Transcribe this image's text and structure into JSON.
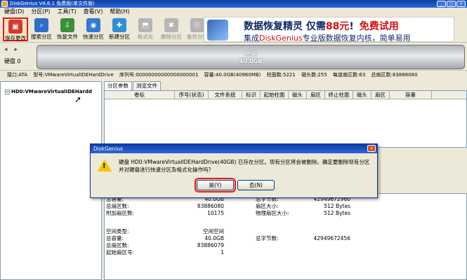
{
  "window": {
    "title": "DiskGenius V4.6.1 免费版(单文件版)",
    "controls": [
      "_",
      "□",
      "×"
    ]
  },
  "menu": [
    "硬盘(D)",
    "分区(P)",
    "工具(T)",
    "查看(V)",
    "帮助(H)"
  ],
  "toolbar": [
    {
      "label": "保存更改",
      "icon": "save-icon",
      "color": "#d33a2c",
      "state": "active"
    },
    {
      "label": "搜索分区",
      "icon": "search-partition-icon",
      "color": "#2d6cc9",
      "state": "normal"
    },
    {
      "label": "恢复文件",
      "icon": "recover-file-icon",
      "color": "#3a8f3a",
      "state": "normal"
    },
    {
      "label": "快速分区",
      "icon": "quick-partition-icon",
      "color": "#3279d1",
      "state": "normal"
    },
    {
      "label": "新建分区",
      "icon": "new-partition-icon",
      "color": "#2f8fd8",
      "state": "normal"
    },
    {
      "label": "格式化",
      "icon": "format-icon",
      "color": "#777777",
      "state": "disabled"
    },
    {
      "label": "删除分区",
      "icon": "delete-partition-icon",
      "color": "#777777",
      "state": "disabled"
    },
    {
      "label": "备份分区",
      "icon": "backup-partition-icon",
      "color": "#777777",
      "state": "disabled"
    }
  ],
  "ad": {
    "line1_a": "数据恢复精灵",
    "line1_b": "仅需",
    "line1_price": "88元",
    "line1_c": "!",
    "line1_buy": "免费试用",
    "line2_a": "集成",
    "line2_brand": "DiskGenius",
    "line2_b": "专业版数据恢复内核，简单易用"
  },
  "disk_strip": {
    "label": "硬盘 0",
    "bar_line1": "空闲",
    "bar_line2": "40.0GB"
  },
  "infobar": [
    "接口:ATA",
    "型号:VMwareVirtualIDEHardDrive",
    "序列号:00000000000000000001",
    "容量:40.0GB(40960MB)",
    "柱面数:5221",
    "磁头数:255",
    "每道扇区数:63",
    "总扇区数:83886080"
  ],
  "tree": {
    "item": "HD0:VMwareVirtualIDEHardd"
  },
  "tabs": [
    "分区参数",
    "浏览文件"
  ],
  "grid_headers": [
    "卷标",
    "序号(状态)",
    "文件系统",
    "标识",
    "起始柱面",
    "磁头",
    "扇区",
    "终止柱面",
    "磁头",
    "扇区",
    "容量"
  ],
  "details": [
    {
      "label": "总容量:",
      "value": "40.0GB",
      "label2": "总字节数:",
      "value2": "42949672960"
    },
    {
      "label": "总扇区数:",
      "value": "83886080",
      "label2": "扇区大小:",
      "value2": "512 Bytes"
    },
    {
      "label": "附加扇区数:",
      "value": "10175",
      "label2": "物理扇区大小:",
      "value2": "512 Bytes"
    },
    {
      "label": "空间类型:",
      "value": "空闲空间",
      "label2": "",
      "value2": ""
    },
    {
      "label": "总容量:",
      "value": "40.0GB",
      "label2": "总字节数:",
      "value2": "42949672456"
    },
    {
      "label": "总扇区数:",
      "value": "83886079",
      "label2": "",
      "value2": ""
    },
    {
      "label": "起始扇区号:",
      "value": "1",
      "label2": "",
      "value2": ""
    }
  ],
  "dialog": {
    "title": "DiskGenius",
    "close": "×",
    "message": "硬盘 HD0:VMwareVirtualIDEHardDrive(40GB) 已存在分区。现有分区将会被删除。确定要删除现有分区并对硬盘进行快速分区及格式化操作吗？",
    "yes": "是(Y)",
    "no": "否(N)"
  }
}
